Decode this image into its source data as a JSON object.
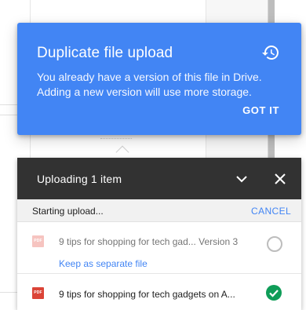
{
  "duplicate_dialog": {
    "title": "Duplicate file upload",
    "message": "You already have a version of this file in Drive. Adding a new version will use more storage.",
    "action_label": "GOT IT",
    "icon": "history-icon"
  },
  "upload_panel": {
    "title": "Uploading 1 item",
    "status_text": "Starting upload...",
    "cancel_label": "CANCEL",
    "files": [
      {
        "icon_label": "PDF",
        "name": "9 tips for shopping for tech gad...",
        "version": "Version 3",
        "link_label": "Keep as separate file",
        "status": "pending"
      },
      {
        "icon_label": "PDF",
        "name": "9 tips for shopping for tech gadgets on A...",
        "status": "complete"
      }
    ]
  },
  "colors": {
    "accent_blue": "#4285f4",
    "header_dark": "#323232",
    "pdf_red": "#db4437",
    "success_green": "#0f9d58"
  }
}
